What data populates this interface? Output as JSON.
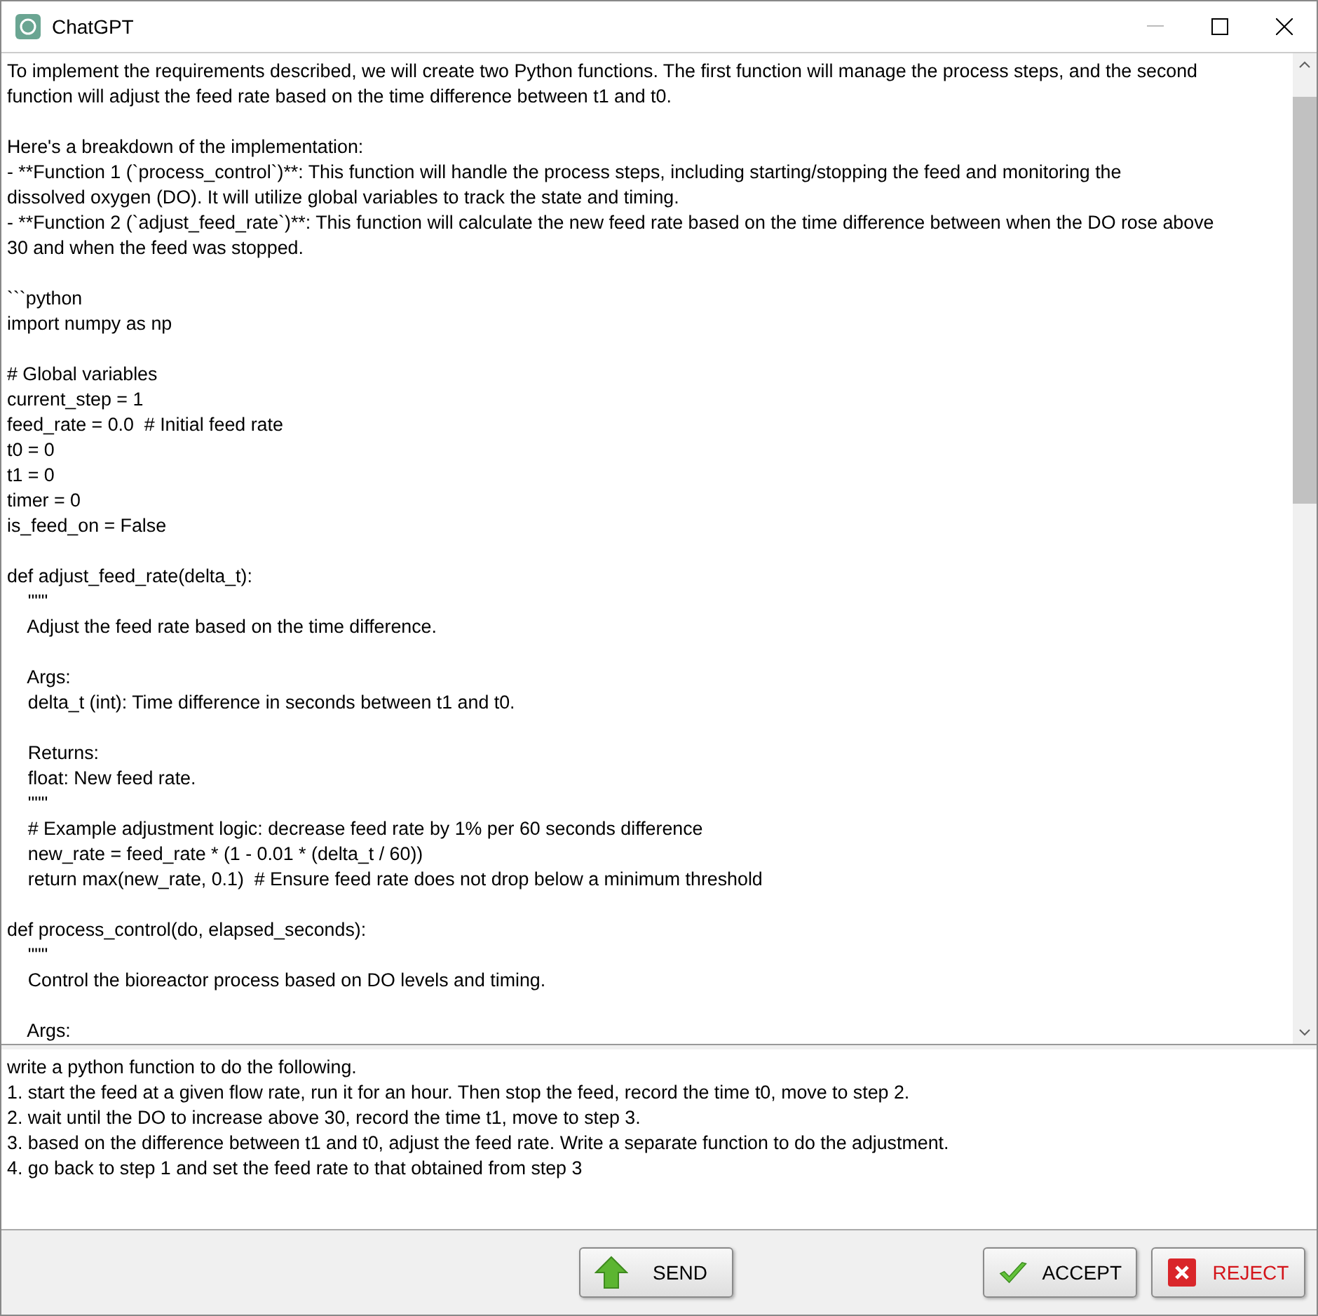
{
  "window": {
    "title": "ChatGPT"
  },
  "output": {
    "blocks": [
      [
        "To implement the requirements described, we will create two Python functions. The first function will manage the process steps, and the second",
        "function will adjust the feed rate based on the time difference between t1 and t0."
      ],
      [
        "Here's a breakdown of the implementation:",
        "- **Function 1 (`process_control`)**: This function will handle the process steps, including starting/stopping the feed and monitoring the",
        "dissolved oxygen (DO). It will utilize global variables to track the state and timing.",
        "- **Function 2 (`adjust_feed_rate`)**: This function will calculate the new feed rate based on the time difference between when the DO rose above",
        "30 and when the feed was stopped."
      ],
      [
        "```python",
        "import numpy as np"
      ],
      [
        "# Global variables",
        "current_step = 1",
        "feed_rate = 0.0  # Initial feed rate",
        "t0 = 0",
        "t1 = 0",
        "timer = 0",
        "is_feed_on = False"
      ],
      [
        "def adjust_feed_rate(delta_t):",
        "    \"\"\"",
        "    Adjust the feed rate based on the time difference."
      ],
      [
        "    Args:",
        "    delta_t (int): Time difference in seconds between t1 and t0."
      ],
      [
        "    Returns:",
        "    float: New feed rate.",
        "    \"\"\"",
        "    # Example adjustment logic: decrease feed rate by 1% per 60 seconds difference",
        "    new_rate = feed_rate * (1 - 0.01 * (delta_t / 60))",
        "    return max(new_rate, 0.1)  # Ensure feed rate does not drop below a minimum threshold"
      ],
      [
        "def process_control(do, elapsed_seconds):",
        "    \"\"\"",
        "    Control the bioreactor process based on DO levels and timing."
      ],
      [
        "    Args:"
      ]
    ]
  },
  "input": {
    "lines": [
      "write a python function to do the following.",
      "1. start the feed at a given flow rate, run it for an hour. Then stop the feed, record the time t0, move to step 2.",
      "2. wait until the DO to increase above 30, record the time t1, move to step 3.",
      "3. based on the difference between t1 and t0, adjust the feed rate. Write a separate function to do the adjustment.",
      "4. go back to step 1 and set the feed rate to that obtained from step 3"
    ]
  },
  "buttons": [
    {
      "kind": "send",
      "label": "SEND"
    },
    {
      "kind": "accept",
      "label": "ACCEPT"
    },
    {
      "kind": "reject",
      "label": "REJECT"
    }
  ]
}
